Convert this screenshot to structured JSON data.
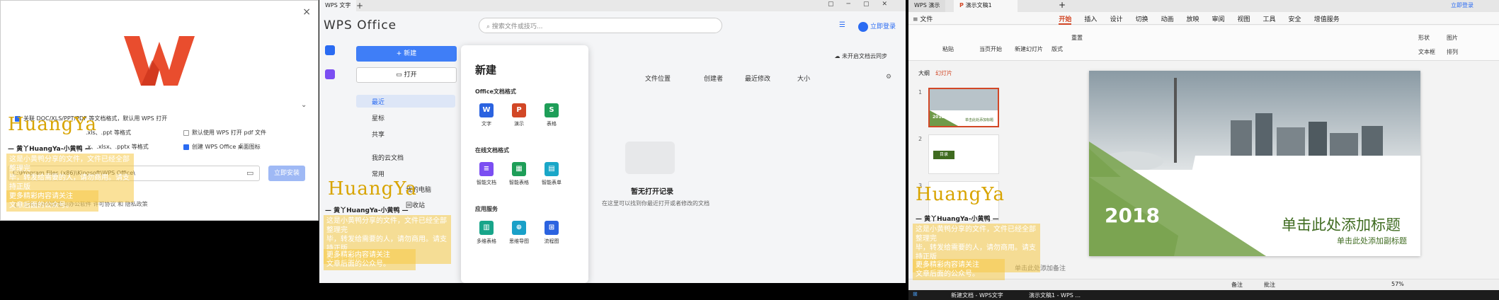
{
  "installer": {
    "close": "×",
    "options": [
      {
        "label": "关联 DOC/XLS/PPT/PDF 等文档格式，默认用 WPS 打开",
        "checked": true
      },
      {
        "label": ".xls、.ppt 等格式",
        "checked": true
      },
      {
        "label": "默认使用 WPS 打开 pdf 文件",
        "checked": false
      },
      {
        "label": ".x、.xlsx、.pptx 等格式",
        "checked": true
      },
      {
        "label": "创建 WPS Office 桌面图标",
        "checked": true
      }
    ],
    "path": "C:\\Program Files (x86)\\Kingsoft\\WPS Office\\",
    "install_button": "立即安装",
    "agreement": "已阅读并同意金山办公软件 许可协议 和 隐私政策"
  },
  "watermark": {
    "logo_text_1": "Huang",
    "logo_text_y": "Y",
    "logo_text_2": "a",
    "subtitle": "— 黄丫HuangYa-小黄鸭 —",
    "line1": "这是小黄鸭分享的文件，文件已经全部整理完",
    "line2": "毕，转发给需要的人，请勿商用。请支持正版",
    "line3": "软件，谢谢。",
    "line4": "更多精彩内容请关注",
    "line5": "文章后面的公众号。"
  },
  "writer": {
    "tab_title": "WPS 文字",
    "brand": "WPS Office",
    "search_placeholder": "搜索文件或技巧...",
    "login": "立即登录",
    "new_button": "+ 新建",
    "open_button": "打开",
    "nav": [
      "最近",
      "星标",
      "共享",
      "我的云文档",
      "常用"
    ],
    "nav_extra": [
      "我的电脑",
      "回收站"
    ],
    "popup": {
      "title": "新建",
      "section1": "Office文档格式",
      "items1": [
        {
          "label": "文字",
          "glyph": "W",
          "color": "#2b63e0"
        },
        {
          "label": "演示",
          "glyph": "P",
          "color": "#d24726"
        },
        {
          "label": "表格",
          "glyph": "S",
          "color": "#1e9e58"
        }
      ],
      "section2": "在线文档格式",
      "items2": [
        {
          "label": "智能文档",
          "glyph": "≡",
          "color": "#7b4ef2"
        },
        {
          "label": "智能表格",
          "glyph": "▦",
          "color": "#1e9e58"
        },
        {
          "label": "智能表单",
          "glyph": "▤",
          "color": "#1aa7c8"
        }
      ],
      "section3": "应用服务",
      "items3": [
        {
          "label": "多维表格",
          "glyph": "▥",
          "color": "#18a58a"
        },
        {
          "label": "思维导图",
          "glyph": "⊕",
          "color": "#19a0c8"
        },
        {
          "label": "流程图",
          "glyph": "⊞",
          "color": "#2b63e0"
        }
      ]
    },
    "columns": [
      "文件位置",
      "创建者",
      "最近修改",
      "大小"
    ],
    "cloud_sync": "未开启文档云同步",
    "empty_title": "暂无打开记录",
    "empty_desc": "在这里可以找到你最近打开或者修改的文档"
  },
  "ppt": {
    "tab1": "WPS 演示",
    "tab2": "演示文稿1",
    "login": "立即登录",
    "menu": [
      "≡ 文件",
      "开始",
      "插入",
      "设计",
      "切换",
      "动画",
      "放映",
      "审阅",
      "视图",
      "工具",
      "安全",
      "增值服务"
    ],
    "ribbon": [
      "粘贴",
      "当页开始",
      "新建幻灯片",
      "版式",
      "重置",
      "形状",
      "图片",
      "文本框",
      "排列"
    ],
    "thumb_tabs": [
      "大纲",
      "幻灯片"
    ],
    "slide_year": "2018",
    "slide_title": "单击此处添加标题",
    "slide_subtitle": "单击此处添加副标题",
    "thumb_texts": [
      "2018",
      "单击此处添加标题",
      "目录"
    ],
    "notes": "单击此处添加备注",
    "status": [
      "备注",
      "批注",
      "57%"
    ]
  },
  "taskbar": {
    "items": [
      "新建文档 - WPS文字",
      "演示文稿1 - WPS ..."
    ]
  }
}
